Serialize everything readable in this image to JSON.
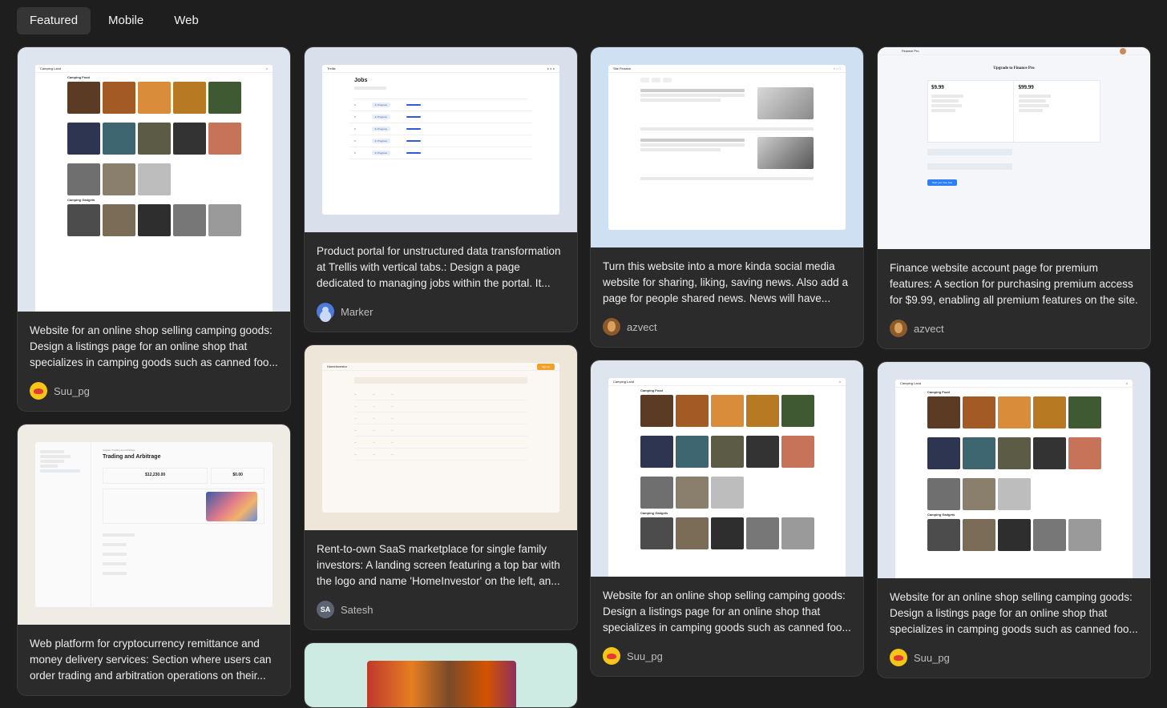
{
  "tabs": [
    {
      "label": "Featured",
      "active": true
    },
    {
      "label": "Mobile",
      "active": false
    },
    {
      "label": "Web",
      "active": false
    }
  ],
  "cards": [
    {
      "description": "Website for an online shop selling camping goods: Design a listings page for an online shop that specializes in camping goods such as canned foo...",
      "author": "Suu_pg"
    },
    {
      "description": "Web platform for cryptocurrency remittance and money delivery services: Section where users can order trading and arbitration operations on their...",
      "author": ""
    },
    {
      "description": "Product portal for unstructured data transformation at Trellis with vertical tabs.: Design a page dedicated to managing jobs within the portal. It...",
      "author": "Marker"
    },
    {
      "description": "Rent-to-own SaaS marketplace for single family investors: A landing screen featuring a top bar with the logo and name 'HomeInvestor' on the left, an...",
      "author": "Satesh",
      "avatar_initials": "SA"
    },
    {
      "description": "Turn this website into a more kinda social media website for sharing, liking, saving news. Also add a page for people shared news. News will have...",
      "author": "azvect"
    },
    {
      "description": "Website for an online shop selling camping goods: Design a listings page for an online shop that specializes in camping goods such as canned foo...",
      "author": "Suu_pg"
    },
    {
      "description": "Finance website account page for premium features: A section for purchasing premium access for $9.99, enabling all premium features on the site.",
      "author": "azvect"
    },
    {
      "description": "Website for an online shop selling camping goods: Design a listings page for an online shop that specializes in camping goods such as canned foo...",
      "author": "Suu_pg"
    }
  ],
  "mini": {
    "camping_brand": "Camping Land",
    "camping_section": "Camping Food",
    "camping_section2": "Camping Gadgets",
    "trellis_brand": "Trellis",
    "trellis_title": "Jobs",
    "home_brand": "HomeInvestor",
    "home_cta": "Sign up",
    "news_brand": "Site Finance",
    "finance_brand": "Finance Pro",
    "finance_title": "Upgrade to Finance Pro",
    "finance_price1": "$9.99",
    "finance_price2": "$99.99",
    "finance_cta": "Start your free trial",
    "crypto_breadcrumb": "Capital / Trading and Arbitrage",
    "crypto_title": "Trading and Arbitrage",
    "crypto_balance": "$12,230.00",
    "crypto_balance2": "$0.00"
  },
  "colors": {
    "background": "#1e1e1e",
    "card": "#2b2b2b",
    "accent": "#2d7ff9"
  }
}
